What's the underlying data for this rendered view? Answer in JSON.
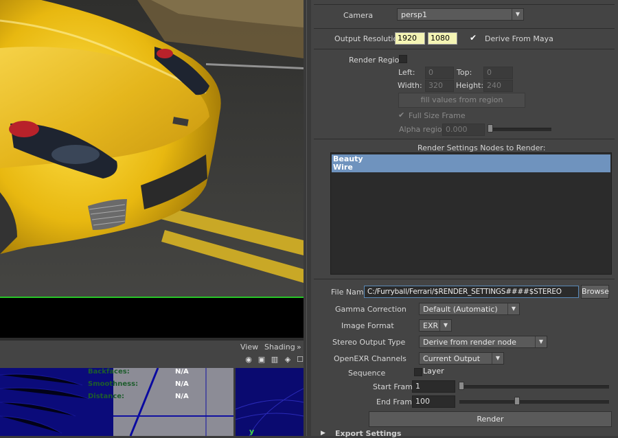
{
  "viewport": {
    "toolbar": {
      "view_menu": "View",
      "shading_menu": "Shading",
      "more": "»"
    }
  },
  "uv_stats": [
    {
      "label": "Backfaces:",
      "value": "N/A"
    },
    {
      "label": "Smoothness:",
      "value": "N/A"
    },
    {
      "label": "Distance:",
      "value": "N/A"
    }
  ],
  "axis_label": "y",
  "camera": {
    "label": "Camera",
    "value": "persp1"
  },
  "output_resolution": {
    "label": "Output Resolution",
    "width": "1920",
    "height": "1080",
    "derive_label": "Derive From Maya",
    "derive_checked": true
  },
  "render_region": {
    "label": "Render Region",
    "left_label": "Left:",
    "left": "0",
    "top_label": "Top:",
    "top": "0",
    "width_label": "Width:",
    "width": "320",
    "height_label": "Height:",
    "height": "240",
    "fill_button": "fill values from region",
    "full_size_label": "Full Size Frame",
    "alpha_label": "Alpha region:",
    "alpha": "0.000"
  },
  "render_nodes": {
    "title": "Render Settings Nodes to Render:",
    "items": [
      "Beauty",
      "Wire"
    ]
  },
  "file_name": {
    "label": "File Name",
    "value": "C:/Furryball/Ferrari/$RENDER_SETTINGS####$STEREO",
    "browse": "Browse"
  },
  "gamma": {
    "label": "Gamma Correction",
    "value": "Default (Automatic)"
  },
  "image_format": {
    "label": "Image Format",
    "value": "EXR"
  },
  "stereo": {
    "label": "Stereo Output Type",
    "value": "Derive from render node"
  },
  "openexr": {
    "label": "OpenEXR Channels",
    "value": "Current Output Layer"
  },
  "sequence": {
    "label": "Sequence"
  },
  "start_frame": {
    "label": "Start Frame",
    "value": "1"
  },
  "end_frame": {
    "label": "End Frame",
    "value": "100"
  },
  "render_button": "Render",
  "export_settings": "Export Settings"
}
